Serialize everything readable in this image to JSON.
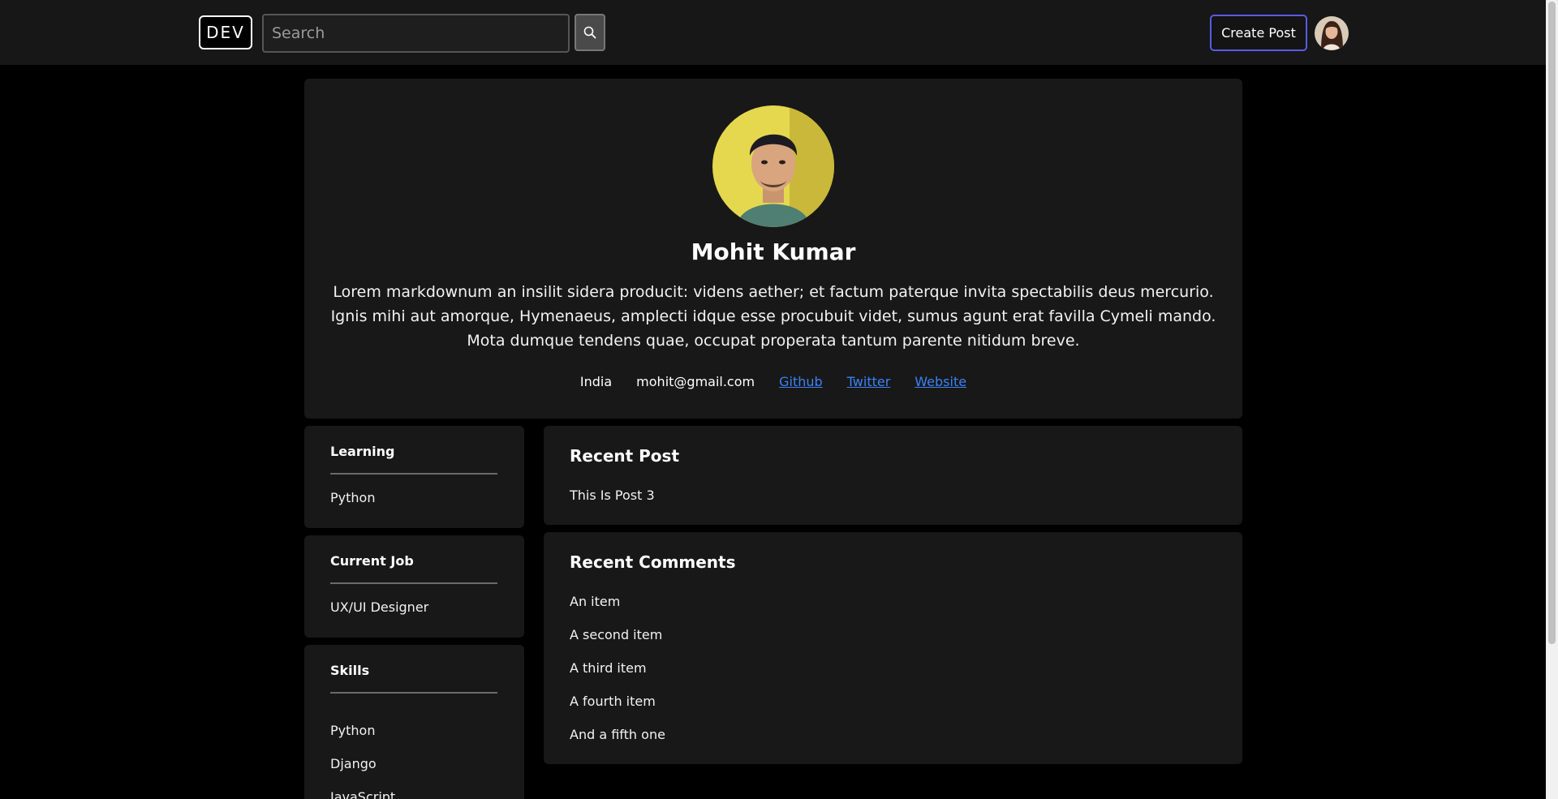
{
  "nav": {
    "logo": "DEV",
    "search_placeholder": "Search",
    "create_post": "Create Post"
  },
  "profile": {
    "name": "Mohit Kumar",
    "bio": "Lorem markdownum an insilit sidera producit: videns aether; et factum paterque invita spectabilis deus mercurio. Ignis mihi aut amorque, Hymenaeus, amplecti idque esse procubuit videt, sumus agunt erat favilla Cymeli mando. Mota dumque tendens quae, occupat properata tantum parente nitidum breve.",
    "location": "India",
    "email": "mohit@gmail.com",
    "links": {
      "github": "Github",
      "twitter": "Twitter",
      "website": "Website"
    }
  },
  "sidebar": {
    "learning": {
      "title": "Learning",
      "items": [
        "Python"
      ]
    },
    "current_job": {
      "title": "Current Job",
      "items": [
        "UX/UI Designer"
      ]
    },
    "skills": {
      "title": "Skills",
      "items": [
        "Python",
        "Django",
        "JavaScript"
      ]
    }
  },
  "recent_post": {
    "title": "Recent Post",
    "items": [
      "This Is Post 3"
    ]
  },
  "recent_comments": {
    "title": "Recent Comments",
    "items": [
      "An item",
      "A second item",
      "A third item",
      "A fourth item",
      "And a fifth one"
    ]
  },
  "colors": {
    "link": "#3b82f6",
    "accent_border": "#5a5ae6",
    "card": "#181818",
    "navbar": "#171717"
  }
}
